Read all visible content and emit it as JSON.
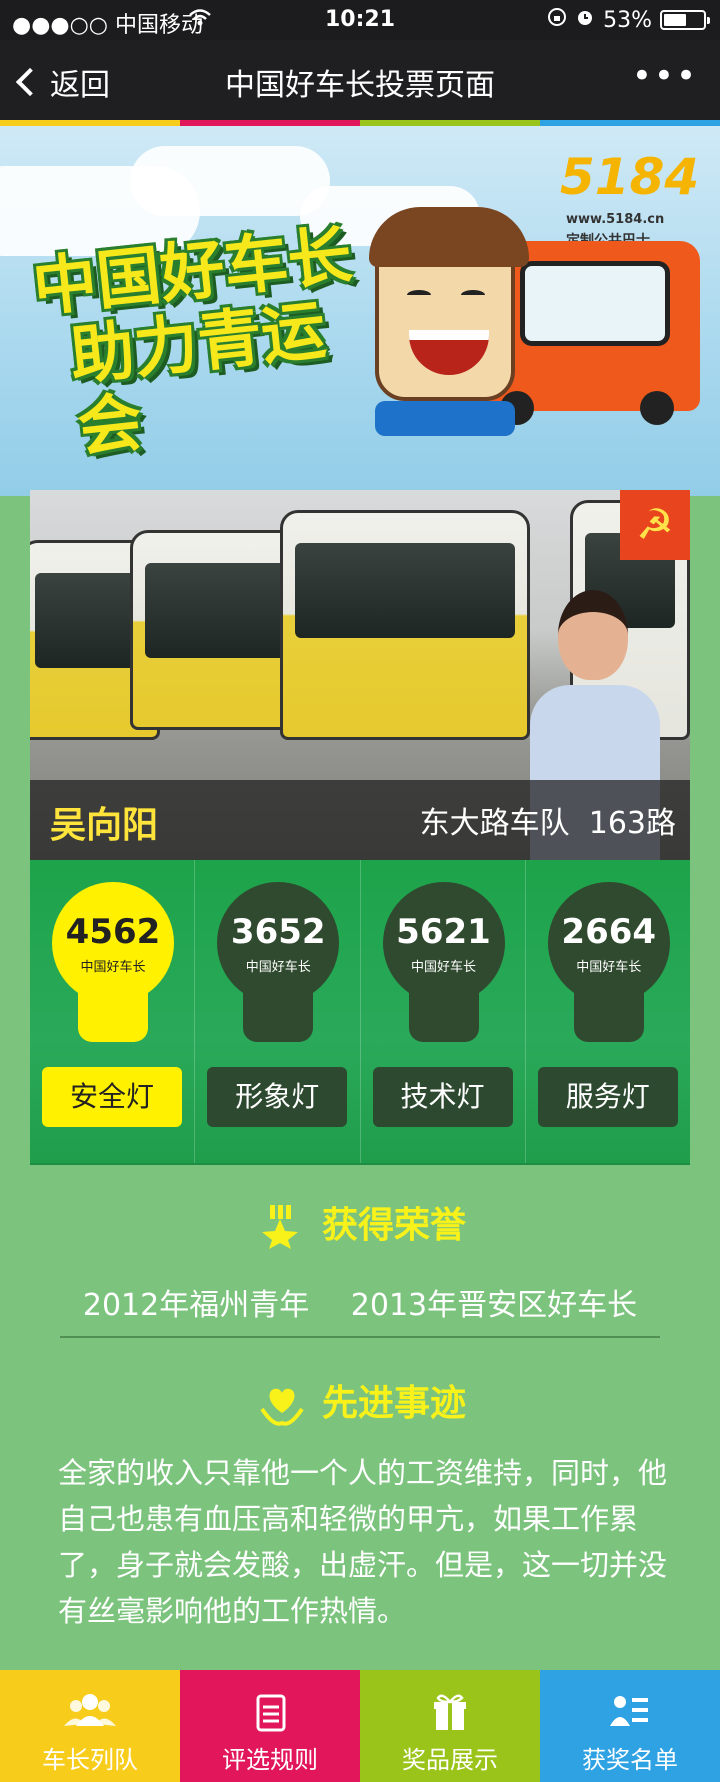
{
  "status_bar": {
    "carrier": "●●●○○ 中国移动",
    "time": "10:21",
    "battery": "53%"
  },
  "nav": {
    "back_label": "返回",
    "title": "中国好车长投票页面",
    "more": "•••"
  },
  "color_strip": [
    "#f8cc1b",
    "#e2165a",
    "#9bc41b",
    "#2ea2e3"
  ],
  "banner": {
    "slogan_line1": "中国好车长",
    "slogan_line2": "助力青运会",
    "logo_text": "5184",
    "logo_url": "www.5184.cn",
    "logo_tagline": "定制公共巴士"
  },
  "candidate": {
    "name": "吴向阳",
    "team": "东大路车队",
    "route": "163路",
    "party_badge": "☭"
  },
  "lights": [
    {
      "count": "4562",
      "sub": "中国好车长",
      "label": "安全灯",
      "active": true
    },
    {
      "count": "3652",
      "sub": "中国好车长",
      "label": "形象灯",
      "active": false
    },
    {
      "count": "5621",
      "sub": "中国好车长",
      "label": "技术灯",
      "active": false
    },
    {
      "count": "2664",
      "sub": "中国好车长",
      "label": "服务灯",
      "active": false
    }
  ],
  "honors": {
    "title": "获得荣誉",
    "items": [
      "2012年福州青年",
      "2013年晋安区好车长"
    ]
  },
  "deeds": {
    "title": "先进事迹",
    "text": "全家的收入只靠他一个人的工资维持，同时，他自己也患有血压高和轻微的甲亢，如果工作累了，身子就会发酸，出虚汗。但是，这一切并没有丝毫影响他的工作热情。"
  },
  "tabs": [
    {
      "label": "车长列队",
      "icon": "users-icon",
      "color": "#f8cc1b"
    },
    {
      "label": "评选规则",
      "icon": "notepad-icon",
      "color": "#e2165a"
    },
    {
      "label": "奖品展示",
      "icon": "gift-icon",
      "color": "#9bc41b"
    },
    {
      "label": "获奖名单",
      "icon": "list-user-icon",
      "color": "#2ea2e3"
    }
  ]
}
